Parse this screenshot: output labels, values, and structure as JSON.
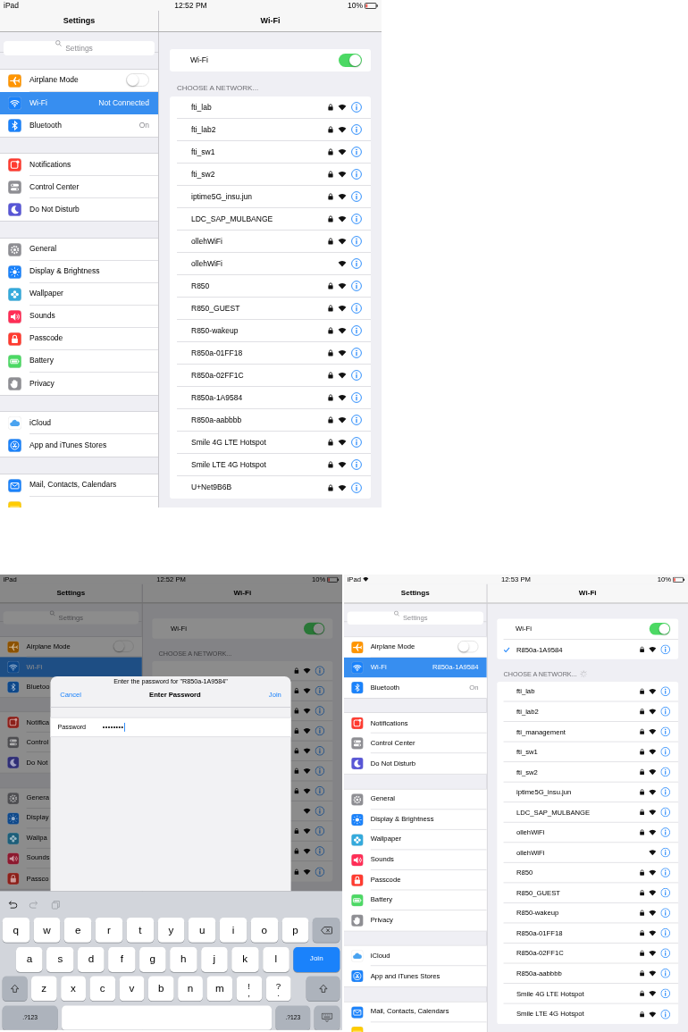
{
  "screens": [
    {
      "status": {
        "device": "iPad",
        "wifi": false,
        "time": "12:52 PM",
        "battery": "10%"
      },
      "sidebar": {
        "title": "Settings",
        "search": {
          "placeholder": "Settings"
        },
        "groups": [
          {
            "items": [
              {
                "kind": "airplane",
                "color": "#ff9500",
                "label": "Airplane Mode",
                "on": false,
                "selected": false
              },
              {
                "kind": "wifi",
                "color": "#1a82fb",
                "label": "Wi-Fi",
                "value": "Not Connected",
                "selected": true
              },
              {
                "kind": "bluetooth",
                "color": "#1a82fb",
                "label": "Bluetooth",
                "value": "On",
                "selected": false
              }
            ]
          },
          {
            "items": [
              {
                "kind": "notifications",
                "color": "#ff3b30",
                "label": "Notifications",
                "selected": false
              },
              {
                "kind": "control",
                "color": "#8e8e93",
                "label": "Control Center",
                "selected": false
              },
              {
                "kind": "moon",
                "color": "#5856d6",
                "label": "Do Not Disturb",
                "selected": false
              }
            ]
          },
          {
            "items": [
              {
                "kind": "gear",
                "color": "#8e8e93",
                "label": "General",
                "selected": false
              },
              {
                "kind": "display",
                "color": "#1a82fb",
                "label": "Display & Brightness",
                "selected": false
              },
              {
                "kind": "wallpaper",
                "color": "#34aadc",
                "label": "Wallpaper",
                "selected": false
              },
              {
                "kind": "sounds",
                "color": "#ff2d55",
                "label": "Sounds",
                "selected": false
              },
              {
                "kind": "passcode",
                "color": "#ff3b30",
                "label": "Passcode",
                "selected": false
              },
              {
                "kind": "battery",
                "color": "#4cd964",
                "label": "Battery",
                "selected": false
              },
              {
                "kind": "privacy",
                "color": "#8e8e93",
                "label": "Privacy",
                "selected": false
              }
            ]
          },
          {
            "items": [
              {
                "kind": "icloud",
                "color": "#ffffff",
                "label": "iCloud",
                "selected": false
              },
              {
                "kind": "appstore",
                "color": "#1a82fb",
                "label": "App and iTunes Stores",
                "selected": false
              }
            ]
          },
          {
            "items": [
              {
                "kind": "mail",
                "color": "#1a82fb",
                "label": "Mail, Contacts, Calendars",
                "selected": false
              },
              {
                "kind": "notes",
                "color": "#ffcc00",
                "selected": false
              }
            ]
          }
        ]
      },
      "detail": {
        "title": "Wi-Fi",
        "wifi": {
          "label": "Wi-Fi",
          "on": true
        },
        "section": "CHOOSE A NETWORK...",
        "loading": false,
        "networks": [
          {
            "name": "fti_lab",
            "locked": true
          },
          {
            "name": "fti_lab2",
            "locked": true
          },
          {
            "name": "fti_sw1",
            "locked": true
          },
          {
            "name": "fti_sw2",
            "locked": true
          },
          {
            "name": "iptime5G_insu.jun",
            "locked": true
          },
          {
            "name": "LDC_SAP_MULBANGE",
            "locked": true
          },
          {
            "name": "ollehWiFi",
            "locked": true
          },
          {
            "name": "ollehWiFi",
            "locked": false
          },
          {
            "name": "R850",
            "locked": true
          },
          {
            "name": "R850_GUEST",
            "locked": true
          },
          {
            "name": "R850-wakeup",
            "locked": true
          },
          {
            "name": "R850a-01FF18",
            "locked": true
          },
          {
            "name": "R850a-02FF1C",
            "locked": true
          },
          {
            "name": "R850a-1A9584",
            "locked": true
          },
          {
            "name": "R850a-aabbbb",
            "locked": true
          },
          {
            "name": "Smile 4G LTE Hotspot",
            "locked": true
          },
          {
            "name": "Smile LTE 4G Hotspot",
            "locked": true
          },
          {
            "name": "U+Net9B6B",
            "locked": true
          }
        ]
      }
    },
    {
      "status": {
        "device": "iPad",
        "wifi": false,
        "time": "12:52 PM",
        "battery": "10%"
      },
      "dimmed": true,
      "sidebar": {
        "title": "Settings",
        "search": {
          "placeholder": "Settings"
        },
        "groups": [
          {
            "items": [
              {
                "kind": "airplane",
                "color": "#8c5200",
                "label": "Airplane Mode",
                "on": false,
                "selected": false
              },
              {
                "kind": "wifi",
                "color": "#0e488a",
                "label": "Wi-Fi",
                "selected": true
              },
              {
                "kind": "bluetooth",
                "color": "#0e488a",
                "label": "Bluetoo",
                "selected": false
              }
            ]
          },
          {
            "items": [
              {
                "kind": "notifications",
                "color": "#8c201a",
                "label": "Notifica",
                "selected": false
              },
              {
                "kind": "control",
                "color": "#4e4e51",
                "label": "Control",
                "selected": false
              },
              {
                "kind": "moon",
                "color": "#302f76",
                "label": "Do Not",
                "selected": false
              }
            ]
          },
          {
            "items": [
              {
                "kind": "gear",
                "color": "#4e4e51",
                "label": "Genera",
                "selected": false
              },
              {
                "kind": "display",
                "color": "#0e488a",
                "label": "Display",
                "selected": false
              },
              {
                "kind": "wallpaper",
                "color": "#1d5e79",
                "label": "Wallpa",
                "selected": false
              },
              {
                "kind": "sounds",
                "color": "#8c192f",
                "label": "Sounds",
                "selected": false
              },
              {
                "kind": "passcode",
                "color": "#8c201a",
                "label": "Passco",
                "selected": false
              }
            ]
          }
        ]
      },
      "detail": {
        "title": "Wi-Fi",
        "wifi": {
          "label": "Wi-Fi",
          "on": true
        },
        "section": "CHOOSE A NETWORK...",
        "loading": false,
        "networks": [
          {
            "locked": true
          },
          {
            "locked": true
          },
          {
            "locked": true
          },
          {
            "locked": true
          },
          {
            "locked": true
          },
          {
            "locked": true
          },
          {
            "locked": true
          },
          {
            "locked": false
          },
          {
            "locked": true
          },
          {
            "locked": true
          },
          {
            "locked": true
          }
        ]
      },
      "dialog": {
        "prompt": "Enter the password for \"R850a-1A9584\"",
        "cancel": "Cancel",
        "title": "Enter Password",
        "join": "Join",
        "field_label": "Password",
        "value": "••••••••"
      },
      "keyboard": {
        "shortcuts": [
          {
            "kind": "undo",
            "disabled": false
          },
          {
            "kind": "redo",
            "disabled": true
          },
          {
            "kind": "paste",
            "disabled": true
          }
        ],
        "rows": [
          [
            {
              "kind": "char",
              "label": "q"
            },
            {
              "kind": "char",
              "label": "w"
            },
            {
              "kind": "char",
              "label": "e"
            },
            {
              "kind": "char",
              "label": "r"
            },
            {
              "kind": "char",
              "label": "t"
            },
            {
              "kind": "char",
              "label": "y"
            },
            {
              "kind": "char",
              "label": "u"
            },
            {
              "kind": "char",
              "label": "i"
            },
            {
              "kind": "char",
              "label": "o"
            },
            {
              "kind": "char",
              "label": "p"
            },
            {
              "kind": "backspace"
            }
          ],
          [
            {
              "kind": "char",
              "label": "a"
            },
            {
              "kind": "char",
              "label": "s"
            },
            {
              "kind": "char",
              "label": "d"
            },
            {
              "kind": "char",
              "label": "f"
            },
            {
              "kind": "char",
              "label": "g"
            },
            {
              "kind": "char",
              "label": "h"
            },
            {
              "kind": "char",
              "label": "j"
            },
            {
              "kind": "char",
              "label": "k"
            },
            {
              "kind": "char",
              "label": "l"
            },
            {
              "kind": "join",
              "label": "Join"
            }
          ],
          [
            {
              "kind": "shift"
            },
            {
              "kind": "char",
              "label": "z"
            },
            {
              "kind": "char",
              "label": "x"
            },
            {
              "kind": "char",
              "label": "c"
            },
            {
              "kind": "char",
              "label": "v"
            },
            {
              "kind": "char",
              "label": "b"
            },
            {
              "kind": "char",
              "label": "n"
            },
            {
              "kind": "char",
              "label": "m"
            },
            {
              "kind": "dual",
              "label": "!",
              "sub": ","
            },
            {
              "kind": "dual",
              "label": "?",
              "sub": "."
            },
            {
              "kind": "shift"
            }
          ],
          [
            {
              "kind": "mode",
              "label": ".?123"
            },
            {
              "kind": "space"
            },
            {
              "kind": "mode",
              "label": ".?123"
            },
            {
              "kind": "hide"
            }
          ]
        ]
      }
    },
    {
      "status": {
        "device": "iPad",
        "wifi": true,
        "time": "12:53 PM",
        "battery": "10%"
      },
      "sidebar": {
        "title": "Settings",
        "search": {
          "placeholder": "Settings"
        },
        "groups": [
          {
            "items": [
              {
                "kind": "airplane",
                "color": "#ff9500",
                "label": "Airplane Mode",
                "on": false,
                "selected": false
              },
              {
                "kind": "wifi",
                "color": "#1a82fb",
                "label": "Wi-Fi",
                "value": "R850a-1A9584",
                "selected": true
              },
              {
                "kind": "bluetooth",
                "color": "#1a82fb",
                "label": "Bluetooth",
                "value": "On",
                "selected": false
              }
            ]
          },
          {
            "items": [
              {
                "kind": "notifications",
                "color": "#ff3b30",
                "label": "Notifications",
                "selected": false
              },
              {
                "kind": "control",
                "color": "#8e8e93",
                "label": "Control Center",
                "selected": false
              },
              {
                "kind": "moon",
                "color": "#5856d6",
                "label": "Do Not Disturb",
                "selected": false
              }
            ]
          },
          {
            "items": [
              {
                "kind": "gear",
                "color": "#8e8e93",
                "label": "General",
                "selected": false
              },
              {
                "kind": "display",
                "color": "#1a82fb",
                "label": "Display & Brightness",
                "selected": false
              },
              {
                "kind": "wallpaper",
                "color": "#34aadc",
                "label": "Wallpaper",
                "selected": false
              },
              {
                "kind": "sounds",
                "color": "#ff2d55",
                "label": "Sounds",
                "selected": false
              },
              {
                "kind": "passcode",
                "color": "#ff3b30",
                "label": "Passcode",
                "selected": false
              },
              {
                "kind": "battery",
                "color": "#4cd964",
                "label": "Battery",
                "selected": false
              },
              {
                "kind": "privacy",
                "color": "#8e8e93",
                "label": "Privacy",
                "selected": false
              }
            ]
          },
          {
            "items": [
              {
                "kind": "icloud",
                "color": "#ffffff",
                "label": "iCloud",
                "selected": false
              },
              {
                "kind": "appstore",
                "color": "#1a82fb",
                "label": "App and iTunes Stores",
                "selected": false
              }
            ]
          },
          {
            "items": [
              {
                "kind": "mail",
                "color": "#1a82fb",
                "label": "Mail, Contacts, Calendars",
                "selected": false
              },
              {
                "kind": "notes",
                "color": "#ffcc00",
                "selected": false
              }
            ]
          }
        ]
      },
      "detail": {
        "title": "Wi-Fi",
        "wifi": {
          "label": "Wi-Fi",
          "on": true
        },
        "connected": {
          "name": "R850a-1A9584",
          "locked": true,
          "checked": true
        },
        "section": "CHOOSE A NETWORK...",
        "loading": true,
        "networks": [
          {
            "name": "fti_lab",
            "locked": true
          },
          {
            "name": "fti_lab2",
            "locked": true
          },
          {
            "name": "fti_management",
            "locked": true
          },
          {
            "name": "fti_sw1",
            "locked": true
          },
          {
            "name": "fti_sw2",
            "locked": true
          },
          {
            "name": "iptime5G_insu.jun",
            "locked": true
          },
          {
            "name": "LDC_SAP_MULBANGE",
            "locked": true
          },
          {
            "name": "ollehWiFi",
            "locked": true
          },
          {
            "name": "ollehWiFi",
            "locked": false
          },
          {
            "name": "R850",
            "locked": true
          },
          {
            "name": "R850_GUEST",
            "locked": true
          },
          {
            "name": "R850-wakeup",
            "locked": true
          },
          {
            "name": "R850a-01FF18",
            "locked": true
          },
          {
            "name": "R850a-02FF1C",
            "locked": true
          },
          {
            "name": "R850a-aabbbb",
            "locked": true
          },
          {
            "name": "Smile 4G LTE Hotspot",
            "locked": true
          },
          {
            "name": "Smile LTE 4G Hotspot",
            "locked": true
          }
        ]
      }
    }
  ]
}
